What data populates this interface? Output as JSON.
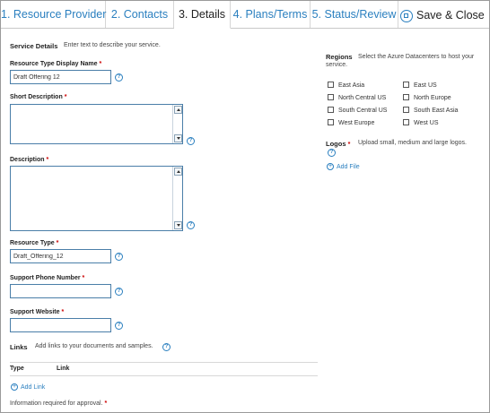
{
  "tabs": [
    {
      "label": "1. Resource Provider",
      "active": false
    },
    {
      "label": "2. Contacts",
      "active": false
    },
    {
      "label": "3. Details",
      "active": true
    },
    {
      "label": "4. Plans/Terms",
      "active": false
    },
    {
      "label": "5. Status/Review",
      "active": false
    }
  ],
  "save_close_label": "Save & Close",
  "service_details": {
    "heading": "Service Details",
    "hint": "Enter text to describe your service."
  },
  "fields": {
    "display_name": {
      "label": "Resource Type Display Name",
      "value": "Draft Offering 12"
    },
    "short_description": {
      "label": "Short Description",
      "value": ""
    },
    "description": {
      "label": "Description",
      "value": ""
    },
    "resource_type": {
      "label": "Resource Type",
      "value": "Draft_Offering_12"
    },
    "support_phone": {
      "label": "Support Phone Number",
      "value": ""
    },
    "support_website": {
      "label": "Support Website",
      "value": ""
    },
    "required_mark": "*"
  },
  "links_section": {
    "heading": "Links",
    "hint": "Add links to your documents and samples.",
    "col_type": "Type",
    "col_link": "Link",
    "add_label": "Add Link"
  },
  "footnote": "Information required for approval.",
  "footnote_mark": "*",
  "regions": {
    "heading": "Regions",
    "hint": "Select the Azure Datacenters to host your service.",
    "items": [
      {
        "label": "East Asia",
        "checked": false
      },
      {
        "label": "East US",
        "checked": false
      },
      {
        "label": "North Central US",
        "checked": false
      },
      {
        "label": "North Europe",
        "checked": false
      },
      {
        "label": "South Central US",
        "checked": false
      },
      {
        "label": "South East Asia",
        "checked": false
      },
      {
        "label": "West Europe",
        "checked": false
      },
      {
        "label": "West US",
        "checked": false
      }
    ]
  },
  "logos": {
    "heading": "Logos",
    "hint": "Upload small, medium and large logos.",
    "add_label": "Add File"
  },
  "help_glyph": "?",
  "plus_glyph": "+"
}
